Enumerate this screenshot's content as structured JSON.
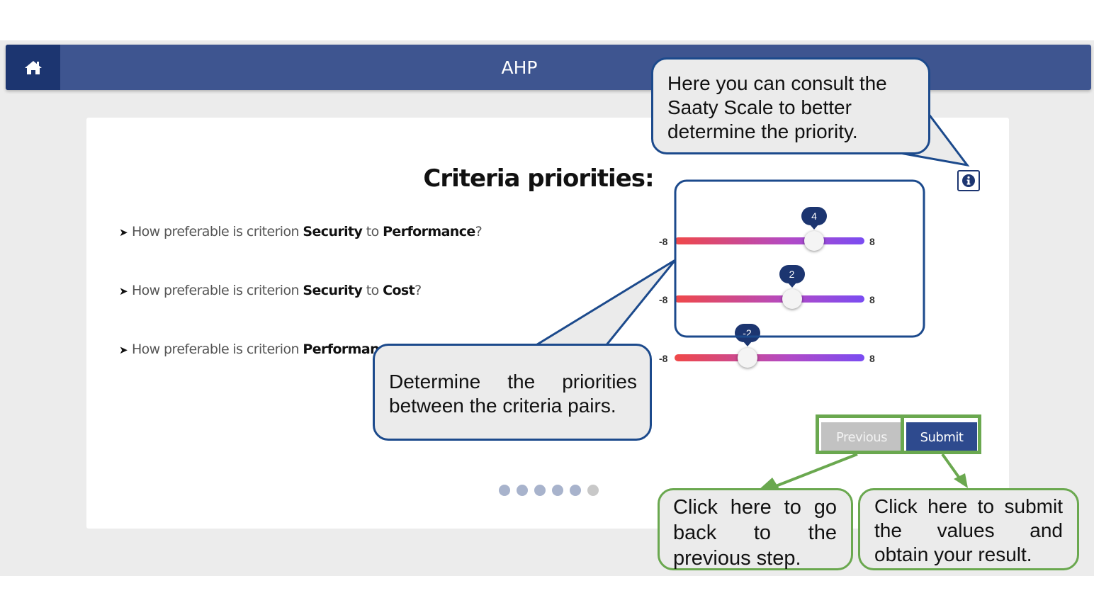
{
  "navbar": {
    "title": "AHP",
    "home_icon": "home-icon"
  },
  "page": {
    "title": "Criteria priorities:"
  },
  "questions": [
    {
      "prefix": "How preferable is criterion ",
      "a": "Security",
      "mid": " to ",
      "b": "Performance",
      "suffix": "?"
    },
    {
      "prefix": "How preferable is criterion ",
      "a": "Security",
      "mid": " to ",
      "b": "Cost",
      "suffix": "?"
    },
    {
      "prefix": "How preferable is criterion ",
      "a": "Performan"
    }
  ],
  "sliders": [
    {
      "min": -8,
      "max": 8,
      "value": 4,
      "min_label": "-8",
      "max_label": "8",
      "value_label": "4"
    },
    {
      "min": -8,
      "max": 8,
      "value": 2,
      "min_label": "-8",
      "max_label": "8",
      "value_label": "2"
    },
    {
      "min": -8,
      "max": 8,
      "value": -2,
      "min_label": "-8",
      "max_label": "8",
      "value_label": "-2"
    }
  ],
  "buttons": {
    "previous": "Previous",
    "submit": "Submit"
  },
  "pagination": {
    "total": 6,
    "current": 5
  },
  "callouts": {
    "saaty": "Here you can consult the Saaty Scale to better determine the priority.",
    "priorities": "Determine the priorities between the criteria pairs.",
    "previous": "Click here to go back to the previous step.",
    "submit": "Click here to submit the values and obtain your result."
  },
  "colors": {
    "navbar": "#3e5590",
    "accent": "#1c3570",
    "callout_border": "#1c4a8c",
    "highlight_green": "#6aa84f"
  }
}
